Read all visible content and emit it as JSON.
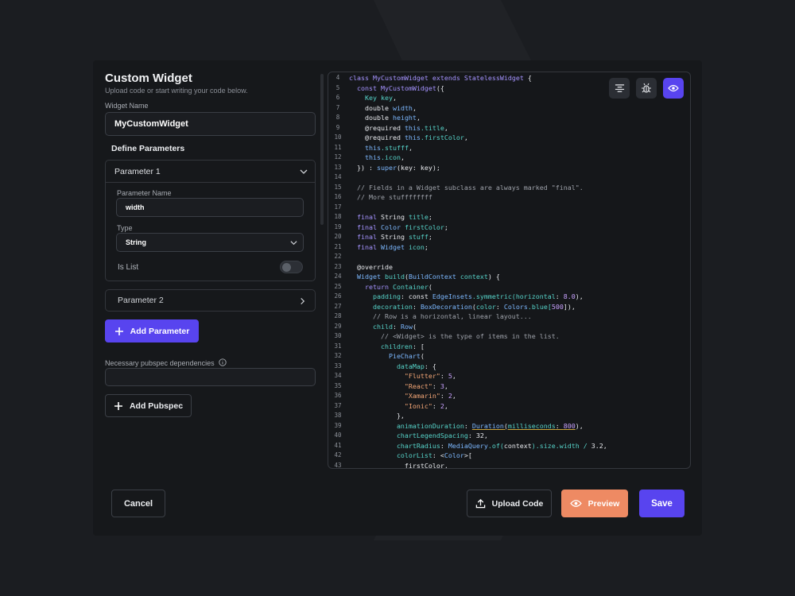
{
  "modal": {
    "title": "Custom Widget",
    "subtitle": "Upload code or start writing your code below."
  },
  "widget_name": {
    "label": "Widget Name",
    "value": "MyCustomWidget"
  },
  "parameters": {
    "section_title": "Define Parameters",
    "param1": {
      "title": "Parameter 1",
      "name_label": "Parameter Name",
      "name_value": "width",
      "type_label": "Type",
      "type_value": "String",
      "is_list_label": "Is List",
      "is_list": false
    },
    "param2": {
      "title": "Parameter 2"
    },
    "add_label": "Add Parameter"
  },
  "pubspec": {
    "label": "Necessary pubspec dependencies",
    "value": "",
    "add_label": "Add Pubspec"
  },
  "code": {
    "lines": [
      {
        "n": "4",
        "t": [
          [
            "class ",
            "k"
          ],
          [
            "MyCustomWidget ",
            "k"
          ],
          [
            "extends ",
            "k"
          ],
          [
            "StatelessWidget",
            "k"
          ],
          [
            " {",
            "w"
          ]
        ]
      },
      {
        "n": "5",
        "t": [
          [
            "  const ",
            "k"
          ],
          [
            "MyCustomWidget",
            "k"
          ],
          [
            "({",
            "w"
          ]
        ]
      },
      {
        "n": "6",
        "t": [
          [
            "    Key ",
            "c"
          ],
          [
            "key",
            "c"
          ],
          [
            ",",
            "w"
          ]
        ]
      },
      {
        "n": "7",
        "t": [
          [
            "    double ",
            "w"
          ],
          [
            "width",
            "p"
          ],
          [
            ",",
            "w"
          ]
        ]
      },
      {
        "n": "8",
        "t": [
          [
            "    double ",
            "w"
          ],
          [
            "height",
            "p"
          ],
          [
            ",",
            "w"
          ]
        ]
      },
      {
        "n": "9",
        "t": [
          [
            "    @required ",
            "w"
          ],
          [
            "this",
            "p"
          ],
          [
            ".title",
            "c"
          ],
          [
            ",",
            "w"
          ]
        ]
      },
      {
        "n": "10",
        "t": [
          [
            "    @required ",
            "w"
          ],
          [
            "this",
            "p"
          ],
          [
            ".firstColor",
            "c"
          ],
          [
            ",",
            "w"
          ]
        ]
      },
      {
        "n": "11",
        "t": [
          [
            "    this",
            "p"
          ],
          [
            ".stufff",
            "c"
          ],
          [
            ",",
            "w"
          ]
        ]
      },
      {
        "n": "12",
        "t": [
          [
            "    this",
            "p"
          ],
          [
            ".icon",
            "c"
          ],
          [
            ",",
            "w"
          ]
        ]
      },
      {
        "n": "13",
        "t": [
          [
            "  }) : ",
            "w"
          ],
          [
            "super",
            "p"
          ],
          [
            "(key: key);",
            "w"
          ]
        ]
      },
      {
        "n": "14",
        "t": []
      },
      {
        "n": "15",
        "t": [
          [
            "  // Fields in a Widget subclass are always marked \"final\".",
            "m"
          ]
        ]
      },
      {
        "n": "16",
        "t": [
          [
            "  // More stuffffffff",
            "m"
          ]
        ]
      },
      {
        "n": "17",
        "t": []
      },
      {
        "n": "18",
        "t": [
          [
            "  final ",
            "k"
          ],
          [
            "String ",
            "w"
          ],
          [
            "title",
            "c"
          ],
          [
            ";",
            "w"
          ]
        ]
      },
      {
        "n": "19",
        "t": [
          [
            "  final ",
            "k"
          ],
          [
            "Color ",
            "p"
          ],
          [
            "firstColor",
            "c"
          ],
          [
            ";",
            "w"
          ]
        ]
      },
      {
        "n": "20",
        "t": [
          [
            "  final ",
            "k"
          ],
          [
            "String ",
            "w"
          ],
          [
            "stuff",
            "c"
          ],
          [
            ";",
            "w"
          ]
        ]
      },
      {
        "n": "21",
        "t": [
          [
            "  final ",
            "k"
          ],
          [
            "Widget ",
            "p"
          ],
          [
            "icon",
            "c"
          ],
          [
            ";",
            "w"
          ]
        ]
      },
      {
        "n": "22",
        "t": []
      },
      {
        "n": "23",
        "t": [
          [
            "  @override",
            "w"
          ]
        ]
      },
      {
        "n": "24",
        "t": [
          [
            "  Widget ",
            "p"
          ],
          [
            "build",
            "c"
          ],
          [
            "(",
            "w"
          ],
          [
            "BuildContext ",
            "p"
          ],
          [
            "context",
            "c"
          ],
          [
            ") {",
            "w"
          ]
        ]
      },
      {
        "n": "25",
        "t": [
          [
            "    return ",
            "k"
          ],
          [
            "Container",
            "c"
          ],
          [
            "(",
            "w"
          ]
        ]
      },
      {
        "n": "26",
        "t": [
          [
            "      padding",
            "c"
          ],
          [
            ": const ",
            "w"
          ],
          [
            "EdgeInsets",
            "p"
          ],
          [
            ".symmetric(",
            "c"
          ],
          [
            "horizontal",
            "c"
          ],
          [
            ": ",
            "w"
          ],
          [
            "8.0",
            "n"
          ],
          [
            "),",
            "w"
          ]
        ]
      },
      {
        "n": "27",
        "t": [
          [
            "      decoration",
            "c"
          ],
          [
            ": ",
            "w"
          ],
          [
            "BoxDecoration",
            "p"
          ],
          [
            "(",
            "w"
          ],
          [
            "color",
            "c"
          ],
          [
            ": ",
            "w"
          ],
          [
            "Colors",
            "p"
          ],
          [
            ".blue[",
            "c"
          ],
          [
            "500",
            "n"
          ],
          [
            "]),",
            "w"
          ]
        ]
      },
      {
        "n": "28",
        "t": [
          [
            "      // Row is a horizontal, linear layout...",
            "m"
          ]
        ]
      },
      {
        "n": "29",
        "t": [
          [
            "      child",
            "c"
          ],
          [
            ": ",
            "w"
          ],
          [
            "Row",
            "p"
          ],
          [
            "(",
            "w"
          ]
        ]
      },
      {
        "n": "30",
        "t": [
          [
            "        // <Widget> is the type of items in the list.",
            "m"
          ]
        ]
      },
      {
        "n": "31",
        "t": [
          [
            "        children",
            "c"
          ],
          [
            ": [",
            "w"
          ]
        ]
      },
      {
        "n": "32",
        "t": [
          [
            "          PieChart",
            "p"
          ],
          [
            "(",
            "w"
          ]
        ]
      },
      {
        "n": "33",
        "t": [
          [
            "            dataMap",
            "c"
          ],
          [
            ": {",
            "w"
          ]
        ]
      },
      {
        "n": "34",
        "t": [
          [
            "              \"Flutter\"",
            "s"
          ],
          [
            ": ",
            "w"
          ],
          [
            "5",
            "n"
          ],
          [
            ",",
            "w"
          ]
        ]
      },
      {
        "n": "35",
        "t": [
          [
            "              \"React\"",
            "s"
          ],
          [
            ": ",
            "w"
          ],
          [
            "3",
            "n"
          ],
          [
            ",",
            "w"
          ]
        ]
      },
      {
        "n": "36",
        "t": [
          [
            "              \"Xamarin\"",
            "s"
          ],
          [
            ": ",
            "w"
          ],
          [
            "2",
            "n"
          ],
          [
            ",",
            "w"
          ]
        ]
      },
      {
        "n": "37",
        "t": [
          [
            "              \"Ionic\"",
            "s"
          ],
          [
            ": ",
            "w"
          ],
          [
            "2",
            "n"
          ],
          [
            ",",
            "w"
          ]
        ]
      },
      {
        "n": "38",
        "t": [
          [
            "            },",
            "w"
          ]
        ]
      },
      {
        "n": "39",
        "t": [
          [
            "            animationDuration",
            "c"
          ],
          [
            ": ",
            "w"
          ],
          [
            "Duration",
            "pu"
          ],
          [
            "(",
            "u"
          ],
          [
            "milliseconds",
            "cu"
          ],
          [
            ": ",
            "u"
          ],
          [
            "800",
            "nu"
          ],
          [
            "),",
            "w"
          ]
        ]
      },
      {
        "n": "40",
        "t": [
          [
            "            chartLegendSpacing",
            "c"
          ],
          [
            ": ",
            "w"
          ],
          [
            "32",
            "w"
          ],
          [
            ",",
            "w"
          ]
        ]
      },
      {
        "n": "41",
        "t": [
          [
            "            chartRadius",
            "c"
          ],
          [
            ": ",
            "w"
          ],
          [
            "MediaQuery",
            "p"
          ],
          [
            ".of(",
            "c"
          ],
          [
            "context",
            "w"
          ],
          [
            ").size.width / ",
            "c"
          ],
          [
            "3.2",
            "w"
          ],
          [
            ",",
            "w"
          ]
        ]
      },
      {
        "n": "42",
        "t": [
          [
            "            colorList",
            "c"
          ],
          [
            ": <",
            "w"
          ],
          [
            "Color",
            "p"
          ],
          [
            ">[",
            "w"
          ]
        ]
      },
      {
        "n": "43",
        "t": [
          [
            "              firstColor",
            "w"
          ],
          [
            ",",
            "w"
          ]
        ]
      }
    ]
  },
  "tools": [
    {
      "name": "format-icon",
      "active": false
    },
    {
      "name": "bug-icon",
      "active": false
    },
    {
      "name": "eye-icon",
      "active": true
    }
  ],
  "footer": {
    "cancel": "Cancel",
    "upload": "Upload Code",
    "preview": "Preview",
    "save": "Save"
  },
  "colors": {
    "accent": "#5844ef",
    "preview": "#ee8a63",
    "background": "#1b1d21",
    "panel": "#16181b"
  }
}
